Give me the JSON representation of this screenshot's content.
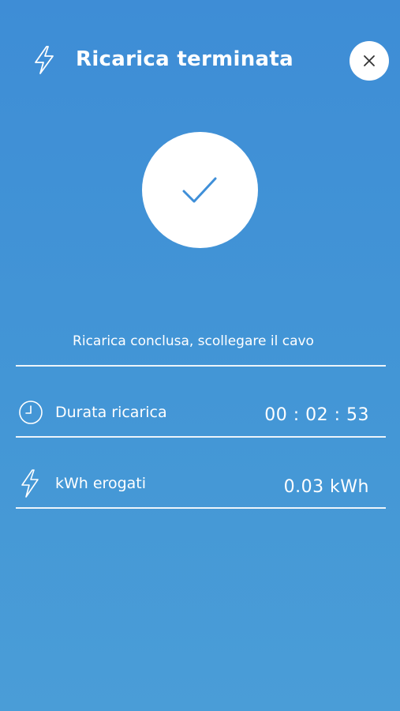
{
  "header": {
    "title": "Ricarica terminata",
    "icon": "lightning-icon",
    "close_icon": "close-icon"
  },
  "status": {
    "icon": "checkmark-icon",
    "message": "Ricarica conclusa, scollegare il cavo"
  },
  "stats": [
    {
      "icon": "clock-icon",
      "label": "Durata ricarica",
      "value": "00 : 02 : 53"
    },
    {
      "icon": "lightning-icon",
      "label": "kWh erogati",
      "value": "0.03 kWh"
    }
  ],
  "colors": {
    "background": "#4193d6",
    "accent": "#3f8fd8",
    "foreground": "#ffffff"
  }
}
